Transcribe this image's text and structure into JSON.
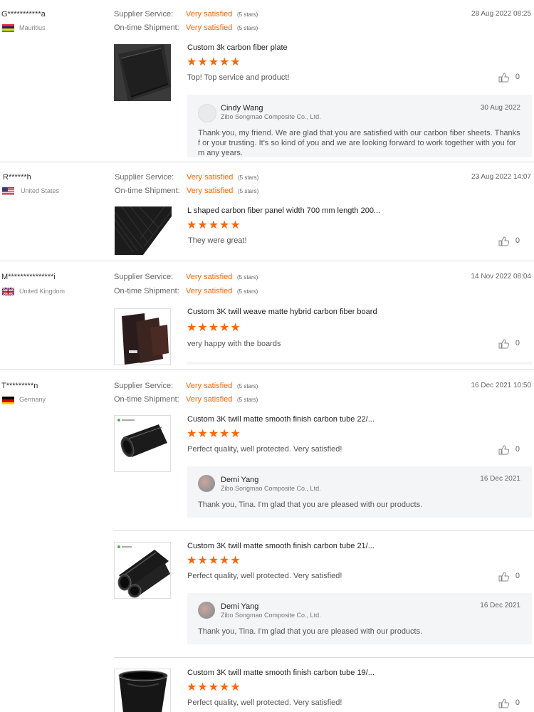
{
  "labels": {
    "supplier_service": "Supplier Service:",
    "ontime_shipment": "On-time Shipment:",
    "very_satisfied": "Very satisfied",
    "five_stars": "(5 stars)",
    "stars": "★★★★★"
  },
  "colors": {
    "accent": "#ff6600",
    "reply_bg": "#f4f5f7",
    "divider": "#dddddd"
  },
  "reviews": [
    {
      "user": "G***********a",
      "country": "Mauritius",
      "flag": "mauritius-flag",
      "date": "28 Aug 2022 08:25",
      "items": [
        {
          "title": "Custom 3k carbon fiber plate",
          "rating": 5,
          "text": "Top! Top service and product!",
          "likes": "0",
          "reply": {
            "name": "Cindy Wang",
            "company": "Zibo Songmao Composite Co., Ltd.",
            "date": "30 Aug 2022",
            "text": "Thank you, my friend. We are glad that you are satisfied with our carbon fiber sheets. Thanks f or  your trusting. It's so kind of you and we are looking forward to work together with you for m any years."
          }
        }
      ]
    },
    {
      "user": "R******h",
      "country": "United States",
      "flag": "usa-flag",
      "date": "23 Aug 2022 14:07",
      "items": [
        {
          "title": "L shaped carbon fiber panel width 700 mm length 200...",
          "rating": 5,
          "text": "They were great!",
          "likes": "0"
        }
      ]
    },
    {
      "user": "M***************i",
      "country": "United Kingdom",
      "flag": "uk-flag",
      "date": "14 Nov 2022 08:04",
      "items": [
        {
          "title": "Custom 3K twill weave matte hybrid carbon fiber board",
          "rating": 5,
          "text": "very happy with the boards",
          "likes": "0"
        }
      ]
    },
    {
      "user": "T*********n",
      "country": "Germany",
      "flag": "germany-flag",
      "date": "16 Dec 2021 10:50",
      "items": [
        {
          "title": "Custom 3K twill matte smooth finish carbon tube 22/...",
          "rating": 5,
          "text": "Perfect quality, well protected. Very satisfied!",
          "likes": "0",
          "reply": {
            "name": "Demi Yang",
            "company": "Zibo Songmao Composite Co., Ltd.",
            "date": "16 Dec 2021",
            "text": "Thank you, Tina. I'm glad that you are pleased with our products."
          }
        },
        {
          "title": "Custom 3K twill matte smooth finish carbon tube 21/...",
          "rating": 5,
          "text": "Perfect quality, well protected. Very satisfied!",
          "likes": "0",
          "reply": {
            "name": "Demi Yang",
            "company": "Zibo Songmao Composite Co., Ltd.",
            "date": "16 Dec 2021",
            "text": "Thank you, Tina. I'm glad that you are pleased with our products."
          }
        },
        {
          "title": "Custom 3K twill matte smooth finish carbon tube 19/...",
          "rating": 5,
          "text": "Perfect quality, well protected. Very satisfied!",
          "likes": "0"
        }
      ]
    }
  ]
}
